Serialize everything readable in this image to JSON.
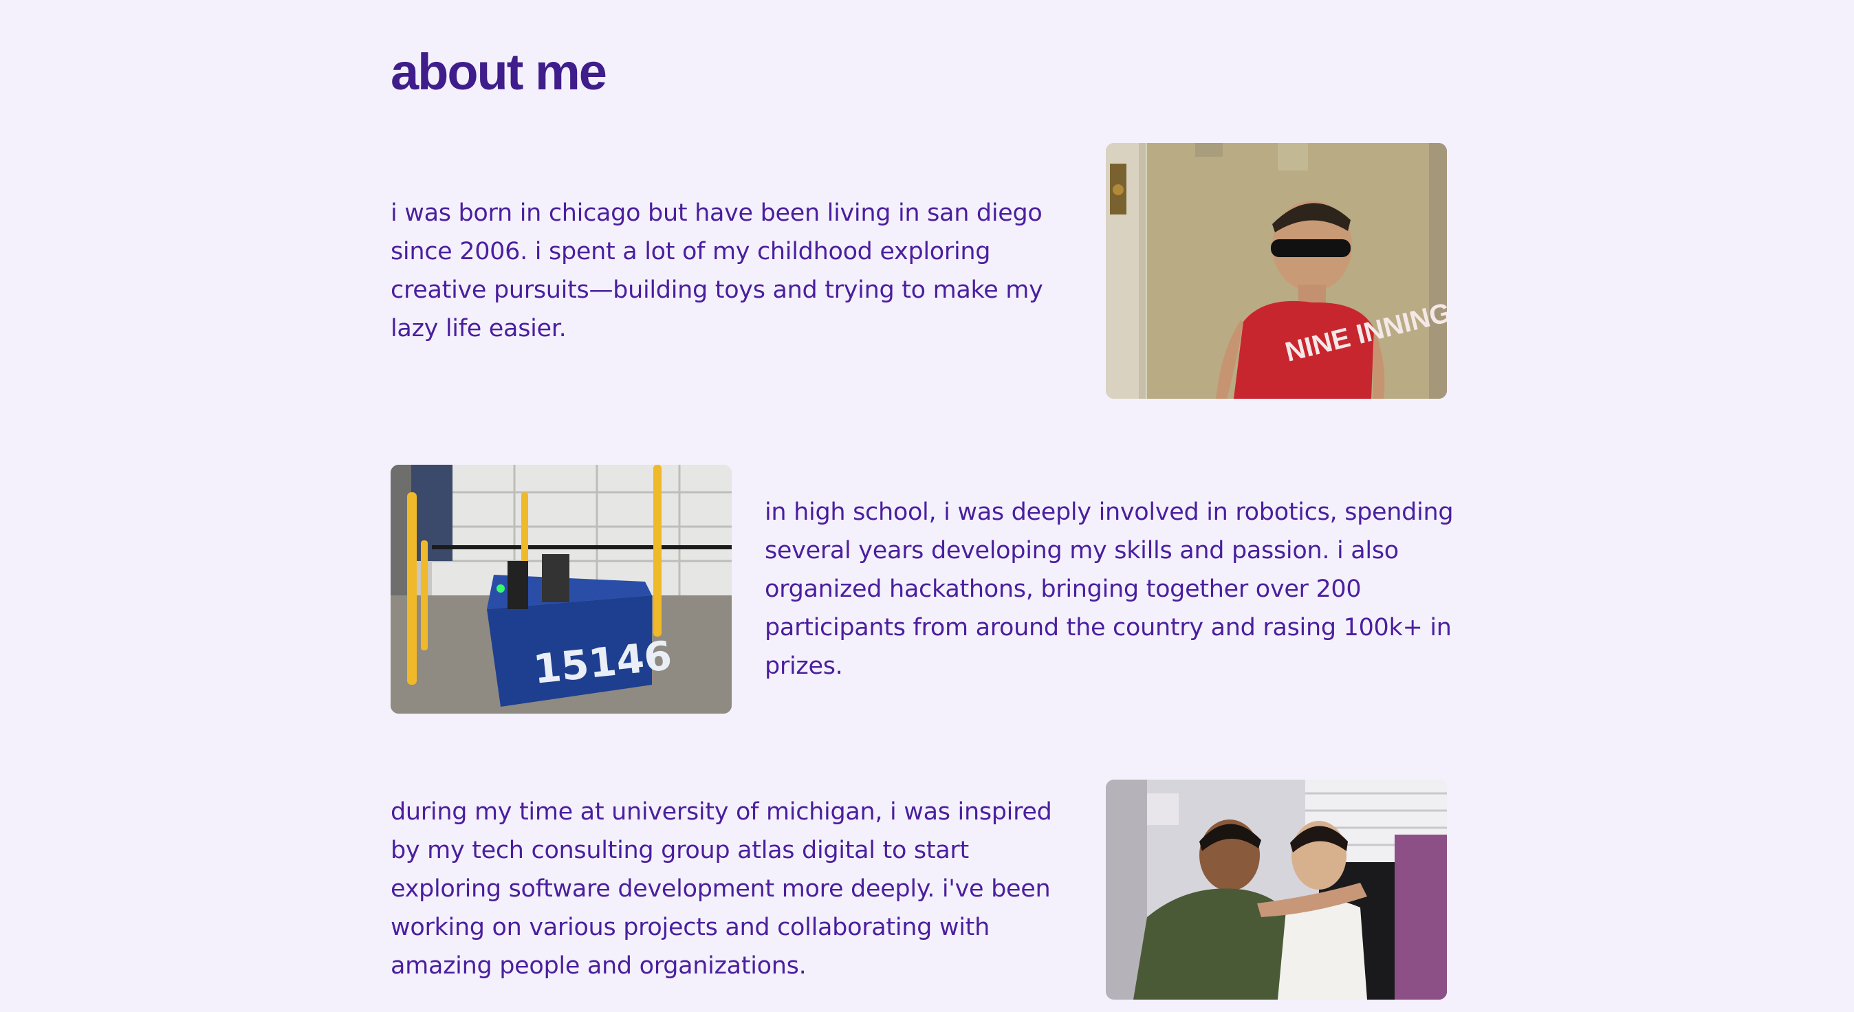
{
  "page": {
    "title": "about me"
  },
  "sections": [
    {
      "text": "i was born in chicago but have been living in san diego since 2006. i spent a lot of my childhood exploring creative pursuits—building toys and trying to make my lazy life easier.",
      "photo_label": "NINE INNINGS"
    },
    {
      "text": "in high school, i was deeply involved in robotics, spending several years developing my skills and passion. i also organized hackathons, bringing together over 200 participants from around the country and rasing 100k+ in prizes.",
      "photo_label": "15146"
    },
    {
      "text": "during my time at university of michigan, i was inspired by my tech consulting group atlas digital to start exploring software development more deeply. i've been working on various projects and collaborating with amazing people and organizations."
    }
  ],
  "colors": {
    "background": "#f4f1fc",
    "heading": "#3f1d8a",
    "body_text": "#4a1f9e"
  }
}
